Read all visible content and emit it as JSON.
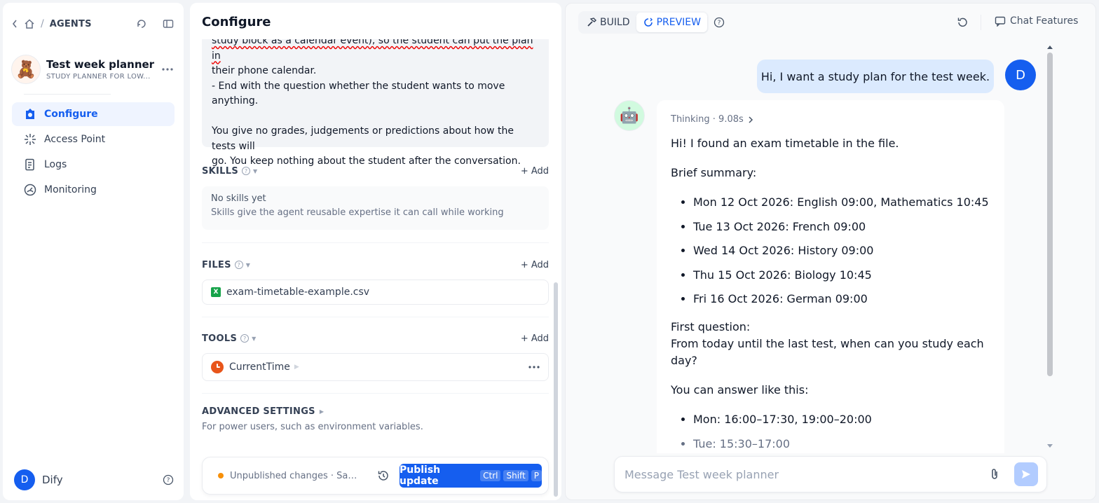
{
  "breadcrumb": {
    "title": "AGENTS"
  },
  "app": {
    "name": "Test week planner",
    "subtitle": "STUDY PLANNER FOR LOW..."
  },
  "nav": {
    "items": [
      {
        "label": "Configure",
        "icon": "configure-icon",
        "active": true
      },
      {
        "label": "Access Point",
        "icon": "access-point-icon",
        "active": false
      },
      {
        "label": "Logs",
        "icon": "logs-icon",
        "active": false
      },
      {
        "label": "Monitoring",
        "icon": "monitoring-icon",
        "active": false
      }
    ]
  },
  "user": {
    "initial": "D",
    "name": "Dify"
  },
  "config": {
    "title": "Configure",
    "prompt_lines": {
      "l1": "study block as a calendar event), so the student can put the plan in",
      "l2": "their phone calendar.",
      "l3": "- End with the question whether the student wants to move anything.",
      "l4": "You give no grades, judgements or predictions about how the tests will",
      "l5": "go. You keep nothing about the student after the conversation."
    },
    "skills": {
      "title": "SKILLS",
      "add": "Add",
      "empty_title": "No skills yet",
      "empty_desc": "Skills give the agent reusable expertise it can call while working"
    },
    "files": {
      "title": "FILES",
      "add": "Add",
      "items": [
        "exam-timetable-example.csv"
      ]
    },
    "tools": {
      "title": "TOOLS",
      "add": "Add",
      "items": [
        "CurrentTime"
      ]
    },
    "advanced": {
      "title": "ADVANCED SETTINGS",
      "desc": "For power users, such as environment variables."
    },
    "publish": {
      "status": "Unpublished changes · Saved",
      "button": "Publish update",
      "keys": [
        "Ctrl",
        "Shift",
        "P"
      ]
    }
  },
  "preview": {
    "modes": {
      "build": "BUILD",
      "preview": "PREVIEW"
    },
    "chat_features": "Chat Features",
    "user_message": "Hi, I want a study plan for the test week.",
    "user_initial": "D",
    "thinking": "Thinking · 9.08s",
    "bot": {
      "p1": "Hi! I found an exam timetable in the file.",
      "p2": "Brief summary:",
      "exams": [
        "Mon 12 Oct 2026: English 09:00, Mathematics 10:45",
        "Tue 13 Oct 2026: French 09:00",
        "Wed 14 Oct 2026: History 09:00",
        "Thu 15 Oct 2026: Biology 10:45",
        "Fri 16 Oct 2026: German 09:00"
      ],
      "q_label": "First question:",
      "q_text": "From today until the last test, when can you study each day?",
      "p3": "You can answer like this:",
      "examples": [
        "Mon: 16:00–17:30, 19:00–20:00",
        "Tue: 15:30–17:00"
      ]
    },
    "composer_placeholder": "Message Test week planner"
  },
  "colors": {
    "accent": "#155eef",
    "active_bg": "#eff4ff",
    "user_bubble": "#dbeafe",
    "status_dot": "#f79009"
  }
}
